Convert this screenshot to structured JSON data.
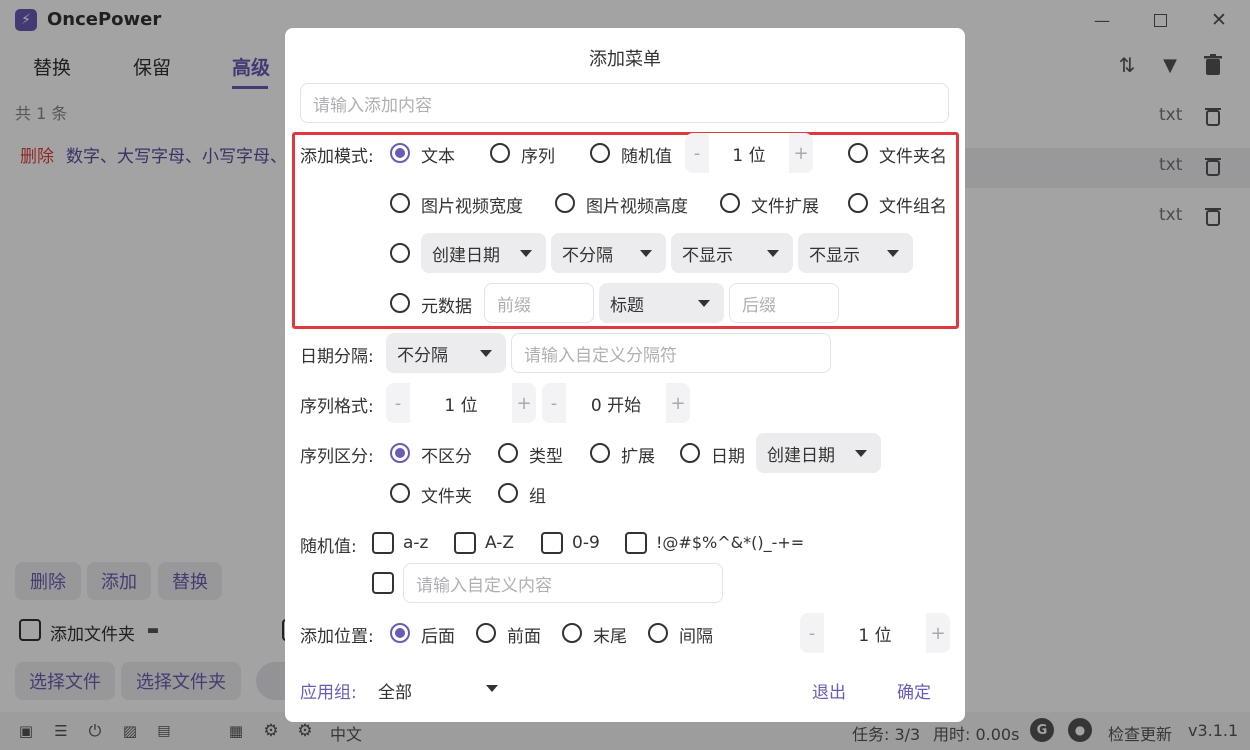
{
  "app": {
    "title": "OncePower",
    "tabs": [
      "替换",
      "保留",
      "高级"
    ],
    "active_tab": "高级",
    "count_label": "共 1 条",
    "rule": {
      "action": "删除",
      "desc": "数字、大写字母、小写字母、"
    },
    "file_ext": [
      "txt",
      "txt",
      "txt"
    ],
    "buttons": {
      "delete": "删除",
      "add": "添加",
      "replace": "替换",
      "select_files": "选择文件",
      "select_folder": "选择文件夹"
    },
    "add_folder_label": "添加文件夹",
    "language": "中文",
    "status": {
      "tasks": "任务: 3/3",
      "time": "用时: 0.00s",
      "check_update": "检查更新",
      "version": "v3.1.1"
    }
  },
  "modal": {
    "title": "添加菜单",
    "content_placeholder": "请输入添加内容",
    "add_mode": {
      "label": "添加模式:",
      "options": {
        "text": "文本",
        "sequence": "序列",
        "random": "随机值",
        "folder_name": "文件夹名",
        "image_width": "图片视频宽度",
        "image_height": "图片视频高度",
        "file_ext": "文件扩展",
        "file_group": "文件组名",
        "metadata": "元数据"
      },
      "selected": "文本",
      "random_length": "1 位",
      "date_selects": [
        "创建日期",
        "不分隔",
        "不显示",
        "不显示"
      ],
      "metadata_prefix_placeholder": "前缀",
      "metadata_field": "标题",
      "metadata_suffix_placeholder": "后缀"
    },
    "date_separator": {
      "label": "日期分隔:",
      "value": "不分隔",
      "placeholder": "请输入自定义分隔符"
    },
    "sequence_format": {
      "label": "序列格式:",
      "digits": "1 位",
      "start": "0 开始"
    },
    "sequence_split": {
      "label": "序列区分:",
      "options": [
        "不区分",
        "类型",
        "扩展",
        "日期",
        "文件夹",
        "组"
      ],
      "selected": "不区分",
      "date_select": "创建日期"
    },
    "random_value": {
      "label": "随机值:",
      "options": [
        "a-z",
        "A-Z",
        "0-9",
        "!@#$%^&*()_-+="
      ],
      "custom_placeholder": "请输入自定义内容"
    },
    "position": {
      "label": "添加位置:",
      "options": [
        "后面",
        "前面",
        "末尾",
        "间隔"
      ],
      "selected": "后面",
      "interval": "1 位"
    },
    "apply_group": {
      "label": "应用组:",
      "value": "全部"
    },
    "buttons": {
      "exit": "退出",
      "confirm": "确定"
    }
  },
  "colors": {
    "accent": "#6a5cb5",
    "highlight_border": "#e0383e",
    "danger": "#e04040"
  }
}
